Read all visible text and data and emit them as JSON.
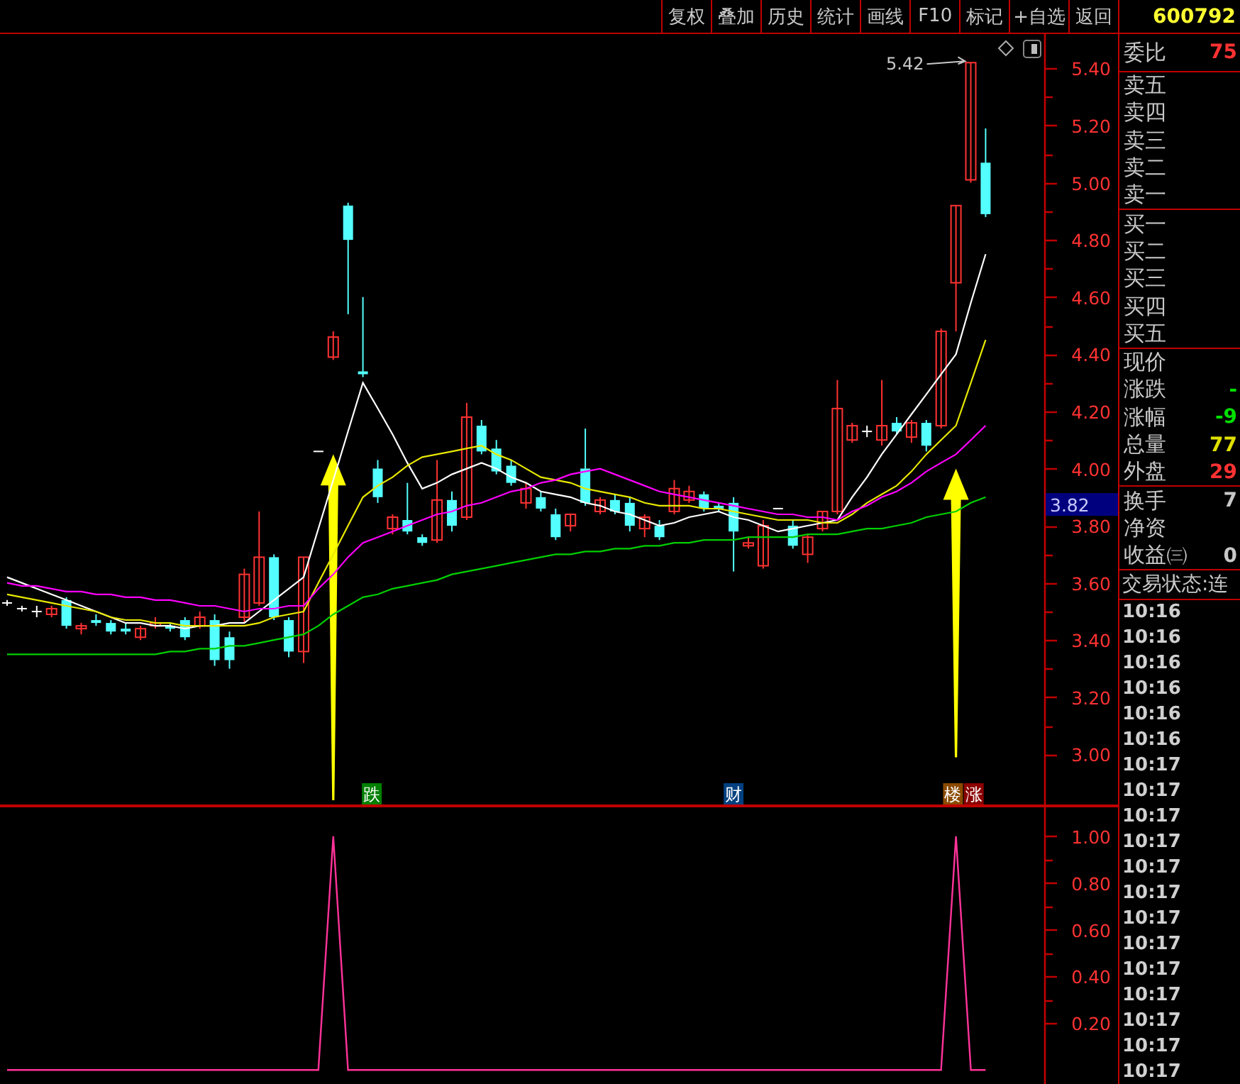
{
  "toolbar": {
    "buttons": [
      "复权",
      "叠加",
      "历史",
      "统计",
      "画线",
      "F10",
      "标记",
      "+自选",
      "返回"
    ]
  },
  "quote": {
    "code": "600792",
    "ratio": {
      "label": "委比",
      "value": "75",
      "color": "#ff3232"
    },
    "asks": [
      {
        "label": "卖五"
      },
      {
        "label": "卖四"
      },
      {
        "label": "卖三"
      },
      {
        "label": "卖二"
      },
      {
        "label": "卖一"
      }
    ],
    "bids": [
      {
        "label": "买一"
      },
      {
        "label": "买二"
      },
      {
        "label": "买三"
      },
      {
        "label": "买四"
      },
      {
        "label": "买五"
      }
    ],
    "stats": [
      {
        "label": "现价"
      },
      {
        "label": "涨跌",
        "value": "-",
        "color": "#00e000"
      },
      {
        "label": "涨幅",
        "value": "-9",
        "color": "#00e000"
      },
      {
        "label": "总量",
        "value": "77",
        "color": "#e0e000"
      },
      {
        "label": "外盘",
        "value": "29",
        "color": "#ff3232"
      }
    ],
    "extra": [
      {
        "label": "换手",
        "value": "7",
        "color": "#c8c8c8"
      },
      {
        "label": "净资"
      },
      {
        "label": "收益㈢",
        "value": "0",
        "color": "#c8c8c8"
      }
    ],
    "status": "交易状态:连",
    "ticks": [
      "10:16",
      "10:16",
      "10:16",
      "10:16",
      "10:16",
      "10:16",
      "10:17",
      "10:17",
      "10:17",
      "10:17",
      "10:17",
      "10:17",
      "10:17",
      "10:17",
      "10:17",
      "10:17",
      "10:17",
      "10:17",
      "10:17"
    ]
  },
  "main_chart": {
    "chart_data": {
      "type": "candlestick",
      "ylim": [
        2.82,
        5.52
      ],
      "yticks": [
        {
          "value": 3.0,
          "label": "3.00"
        },
        {
          "value": 3.2,
          "label": "3.20"
        },
        {
          "value": 3.4,
          "label": "3.40"
        },
        {
          "value": 3.6,
          "label": "3.60"
        },
        {
          "value": 3.8,
          "label": "3.80"
        },
        {
          "value": 4.0,
          "label": "4.00"
        },
        {
          "value": 4.2,
          "label": "4.20"
        },
        {
          "value": 4.4,
          "label": "4.40"
        },
        {
          "value": 4.6,
          "label": "4.60"
        },
        {
          "value": 4.8,
          "label": "4.80"
        },
        {
          "value": 5.0,
          "label": "5.00"
        },
        {
          "value": 5.2,
          "label": "5.20"
        },
        {
          "value": 5.4,
          "label": "5.40"
        }
      ],
      "ohlc": [
        [
          3.53,
          3.54,
          3.52,
          3.53
        ],
        [
          3.51,
          3.52,
          3.5,
          3.51
        ],
        [
          3.5,
          3.52,
          3.48,
          3.5
        ],
        [
          3.49,
          3.52,
          3.48,
          3.51
        ],
        [
          3.54,
          3.55,
          3.44,
          3.45
        ],
        [
          3.44,
          3.46,
          3.42,
          3.45
        ],
        [
          3.47,
          3.49,
          3.45,
          3.46
        ],
        [
          3.46,
          3.47,
          3.42,
          3.43
        ],
        [
          3.44,
          3.46,
          3.42,
          3.43
        ],
        [
          3.41,
          3.45,
          3.4,
          3.44
        ],
        [
          3.45,
          3.48,
          3.44,
          3.46
        ],
        [
          3.45,
          3.46,
          3.43,
          3.44
        ],
        [
          3.47,
          3.48,
          3.4,
          3.41
        ],
        [
          3.45,
          3.5,
          3.44,
          3.48
        ],
        [
          3.47,
          3.49,
          3.31,
          3.33
        ],
        [
          3.41,
          3.43,
          3.3,
          3.33
        ],
        [
          3.48,
          3.65,
          3.46,
          3.63
        ],
        [
          3.53,
          3.85,
          3.52,
          3.69
        ],
        [
          3.69,
          3.7,
          3.47,
          3.48
        ],
        [
          3.47,
          3.48,
          3.34,
          3.36
        ],
        [
          3.36,
          3.69,
          3.32,
          3.69
        ],
        [
          4.06,
          4.06,
          4.06,
          4.06
        ],
        [
          4.39,
          4.48,
          4.38,
          4.46
        ],
        [
          4.92,
          4.93,
          4.54,
          4.8
        ],
        [
          4.34,
          4.6,
          4.32,
          4.33
        ],
        [
          4.0,
          4.03,
          3.88,
          3.9
        ],
        [
          3.79,
          3.84,
          3.77,
          3.83
        ],
        [
          3.82,
          3.95,
          3.77,
          3.78
        ],
        [
          3.76,
          3.77,
          3.73,
          3.74
        ],
        [
          3.75,
          4.03,
          3.74,
          3.89
        ],
        [
          3.89,
          3.92,
          3.78,
          3.8
        ],
        [
          3.83,
          4.23,
          3.82,
          4.18
        ],
        [
          4.15,
          4.17,
          4.05,
          4.06
        ],
        [
          4.07,
          4.1,
          3.98,
          3.99
        ],
        [
          4.01,
          4.03,
          3.94,
          3.95
        ],
        [
          3.88,
          3.95,
          3.86,
          3.93
        ],
        [
          3.9,
          3.92,
          3.85,
          3.86
        ],
        [
          3.84,
          3.86,
          3.75,
          3.76
        ],
        [
          3.8,
          3.84,
          3.78,
          3.84
        ],
        [
          4.0,
          4.14,
          3.87,
          3.88
        ],
        [
          3.85,
          3.9,
          3.84,
          3.89
        ],
        [
          3.89,
          3.91,
          3.84,
          3.85
        ],
        [
          3.88,
          3.9,
          3.78,
          3.8
        ],
        [
          3.79,
          3.84,
          3.76,
          3.83
        ],
        [
          3.8,
          3.82,
          3.75,
          3.76
        ],
        [
          3.85,
          3.96,
          3.84,
          3.93
        ],
        [
          3.89,
          3.94,
          3.88,
          3.92
        ],
        [
          3.91,
          3.92,
          3.85,
          3.86
        ],
        [
          3.87,
          3.88,
          3.85,
          3.86
        ],
        [
          3.88,
          3.9,
          3.64,
          3.78
        ],
        [
          3.73,
          3.76,
          3.72,
          3.74
        ],
        [
          3.66,
          3.82,
          3.65,
          3.8
        ],
        [
          3.86,
          3.86,
          3.86,
          3.86
        ],
        [
          3.8,
          3.82,
          3.72,
          3.73
        ],
        [
          3.7,
          3.77,
          3.67,
          3.76
        ],
        [
          3.79,
          3.85,
          3.78,
          3.85
        ],
        [
          3.85,
          4.31,
          3.84,
          4.21
        ],
        [
          4.1,
          4.16,
          4.09,
          4.15
        ],
        [
          4.13,
          4.15,
          4.11,
          4.13
        ],
        [
          4.1,
          4.31,
          4.08,
          4.15
        ],
        [
          4.16,
          4.18,
          4.12,
          4.13
        ],
        [
          4.11,
          4.17,
          4.09,
          4.16
        ],
        [
          4.16,
          4.17,
          4.06,
          4.08
        ],
        [
          4.15,
          4.49,
          4.14,
          4.48
        ],
        [
          4.65,
          4.92,
          4.48,
          4.92
        ],
        [
          5.01,
          5.42,
          5.0,
          5.42
        ],
        [
          5.07,
          5.19,
          4.88,
          4.89
        ]
      ],
      "series": [
        {
          "type": "line",
          "color": "#ffffff",
          "values": [
            3.62,
            3.6,
            3.58,
            3.56,
            3.54,
            3.52,
            3.5,
            3.48,
            3.46,
            3.46,
            3.45,
            3.45,
            3.44,
            3.45,
            3.45,
            3.46,
            3.46,
            3.5,
            3.54,
            3.58,
            3.62,
            3.79,
            3.96,
            4.13,
            4.3,
            4.21,
            4.12,
            4.02,
            3.93,
            3.95,
            3.98,
            4.0,
            4.02,
            4.0,
            3.97,
            3.95,
            3.92,
            3.91,
            3.9,
            3.88,
            3.87,
            3.85,
            3.84,
            3.82,
            3.8,
            3.81,
            3.83,
            3.84,
            3.85,
            3.83,
            3.82,
            3.8,
            3.78,
            3.79,
            3.8,
            3.81,
            3.82,
            3.9,
            3.97,
            4.05,
            4.12,
            4.19,
            4.26,
            4.33,
            4.4,
            4.58,
            4.75
          ]
        },
        {
          "type": "line",
          "color": "#e8e800",
          "values": [
            3.56,
            3.55,
            3.54,
            3.53,
            3.52,
            3.51,
            3.5,
            3.48,
            3.47,
            3.47,
            3.46,
            3.46,
            3.45,
            3.45,
            3.45,
            3.45,
            3.45,
            3.46,
            3.48,
            3.49,
            3.5,
            3.6,
            3.7,
            3.8,
            3.9,
            3.94,
            3.97,
            4.01,
            4.04,
            4.05,
            4.06,
            4.07,
            4.08,
            4.05,
            4.03,
            4.0,
            3.97,
            3.96,
            3.95,
            3.93,
            3.92,
            3.91,
            3.9,
            3.88,
            3.87,
            3.87,
            3.87,
            3.86,
            3.86,
            3.85,
            3.84,
            3.83,
            3.82,
            3.82,
            3.82,
            3.81,
            3.81,
            3.84,
            3.88,
            3.91,
            3.94,
            3.99,
            4.05,
            4.1,
            4.15,
            4.3,
            4.45
          ]
        },
        {
          "type": "line",
          "color": "#ff00ff",
          "values": [
            3.6,
            3.59,
            3.59,
            3.58,
            3.57,
            3.57,
            3.56,
            3.56,
            3.55,
            3.55,
            3.54,
            3.54,
            3.53,
            3.52,
            3.52,
            3.51,
            3.5,
            3.51,
            3.51,
            3.52,
            3.52,
            3.58,
            3.63,
            3.69,
            3.74,
            3.76,
            3.78,
            3.8,
            3.82,
            3.84,
            3.85,
            3.87,
            3.88,
            3.9,
            3.92,
            3.93,
            3.95,
            3.96,
            3.98,
            3.99,
            4.0,
            3.98,
            3.96,
            3.94,
            3.92,
            3.91,
            3.9,
            3.89,
            3.88,
            3.87,
            3.86,
            3.85,
            3.84,
            3.84,
            3.83,
            3.83,
            3.82,
            3.85,
            3.87,
            3.9,
            3.92,
            3.95,
            3.99,
            4.02,
            4.05,
            4.1,
            4.15
          ]
        },
        {
          "type": "line",
          "color": "#00d000",
          "values": [
            3.35,
            3.35,
            3.35,
            3.35,
            3.35,
            3.35,
            3.35,
            3.35,
            3.35,
            3.35,
            3.35,
            3.36,
            3.36,
            3.37,
            3.37,
            3.38,
            3.38,
            3.39,
            3.4,
            3.41,
            3.42,
            3.45,
            3.49,
            3.52,
            3.55,
            3.56,
            3.58,
            3.59,
            3.6,
            3.61,
            3.63,
            3.64,
            3.65,
            3.66,
            3.67,
            3.68,
            3.69,
            3.7,
            3.7,
            3.71,
            3.71,
            3.72,
            3.72,
            3.73,
            3.73,
            3.74,
            3.74,
            3.75,
            3.75,
            3.75,
            3.76,
            3.76,
            3.76,
            3.76,
            3.77,
            3.77,
            3.77,
            3.78,
            3.79,
            3.79,
            3.8,
            3.81,
            3.83,
            3.84,
            3.85,
            3.88,
            3.9
          ]
        }
      ],
      "annotations": [
        "5.42"
      ]
    },
    "price_tag": "3.82",
    "signal_tags": [
      {
        "label": "跌",
        "color": "#008000"
      },
      {
        "label": "财",
        "color": "#004080"
      },
      {
        "label": "楼",
        "color": "#8b4a00"
      },
      {
        "label": "涨",
        "color": "#8b0000"
      }
    ]
  },
  "sub_chart": {
    "chart_data": {
      "type": "line",
      "ylim": [
        -0.06,
        1.13
      ],
      "yticks": [
        {
          "value": 0.2,
          "label": "0.20"
        },
        {
          "value": 0.4,
          "label": "0.40"
        },
        {
          "value": 0.6,
          "label": "0.60"
        },
        {
          "value": 0.8,
          "label": "0.80"
        },
        {
          "value": 1.0,
          "label": "1.00"
        }
      ],
      "series": [
        {
          "color": "#ff3399",
          "values": [
            0,
            0,
            0,
            0,
            0,
            0,
            0,
            0,
            0,
            0,
            0,
            0,
            0,
            0,
            0,
            0,
            0,
            0,
            0,
            0,
            0,
            0,
            1,
            0,
            0,
            0,
            0,
            0,
            0,
            0,
            0,
            0,
            0,
            0,
            0,
            0,
            0,
            0,
            0,
            0,
            0,
            0,
            0,
            0,
            0,
            0,
            0,
            0,
            0,
            0,
            0,
            0,
            0,
            0,
            0,
            0,
            0,
            0,
            0,
            0,
            0,
            0,
            0,
            0,
            1,
            0,
            0
          ]
        }
      ]
    }
  }
}
